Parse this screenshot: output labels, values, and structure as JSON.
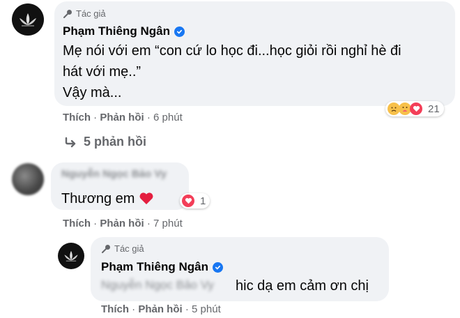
{
  "comment1": {
    "author_tag": "Tác giả",
    "name": "Phạm Thiêng Ngân",
    "text_line1": "Mẹ nói với em “con cứ lo học đi...học giỏi rồi nghỉ hè đi",
    "text_line2": "hát với mẹ..”",
    "text_line3": "Vậy mà...",
    "actions": {
      "like": "Thích",
      "reply": "Phản hồi",
      "time": "6 phút"
    },
    "reactions": {
      "icons": [
        "sad-face",
        "hug-face",
        "heart"
      ],
      "count": "21"
    },
    "replies_link": "5 phản hồi"
  },
  "comment2": {
    "name_blurred": "Nguyễn Ngọc Bảo Vy",
    "text": "Thương em",
    "emoji": "❤️",
    "reactions": {
      "icons": [
        "heart"
      ],
      "count": "1"
    },
    "actions": {
      "like": "Thích",
      "reply": "Phản hồi",
      "time": "7 phút"
    }
  },
  "comment3": {
    "author_tag": "Tác giả",
    "name": "Phạm Thiêng Ngân",
    "mention_blurred": "Nguyễn Ngọc Bảo Vy",
    "text": "hic dạ em cảm ơn chị",
    "actions": {
      "like": "Thích",
      "reply": "Phản hồi",
      "time": "5 phút"
    }
  },
  "colors": {
    "bubble": "#f0f2f5",
    "secondary_text": "#65676b",
    "verified": "#1877f2",
    "heart": "#e41e3f"
  }
}
